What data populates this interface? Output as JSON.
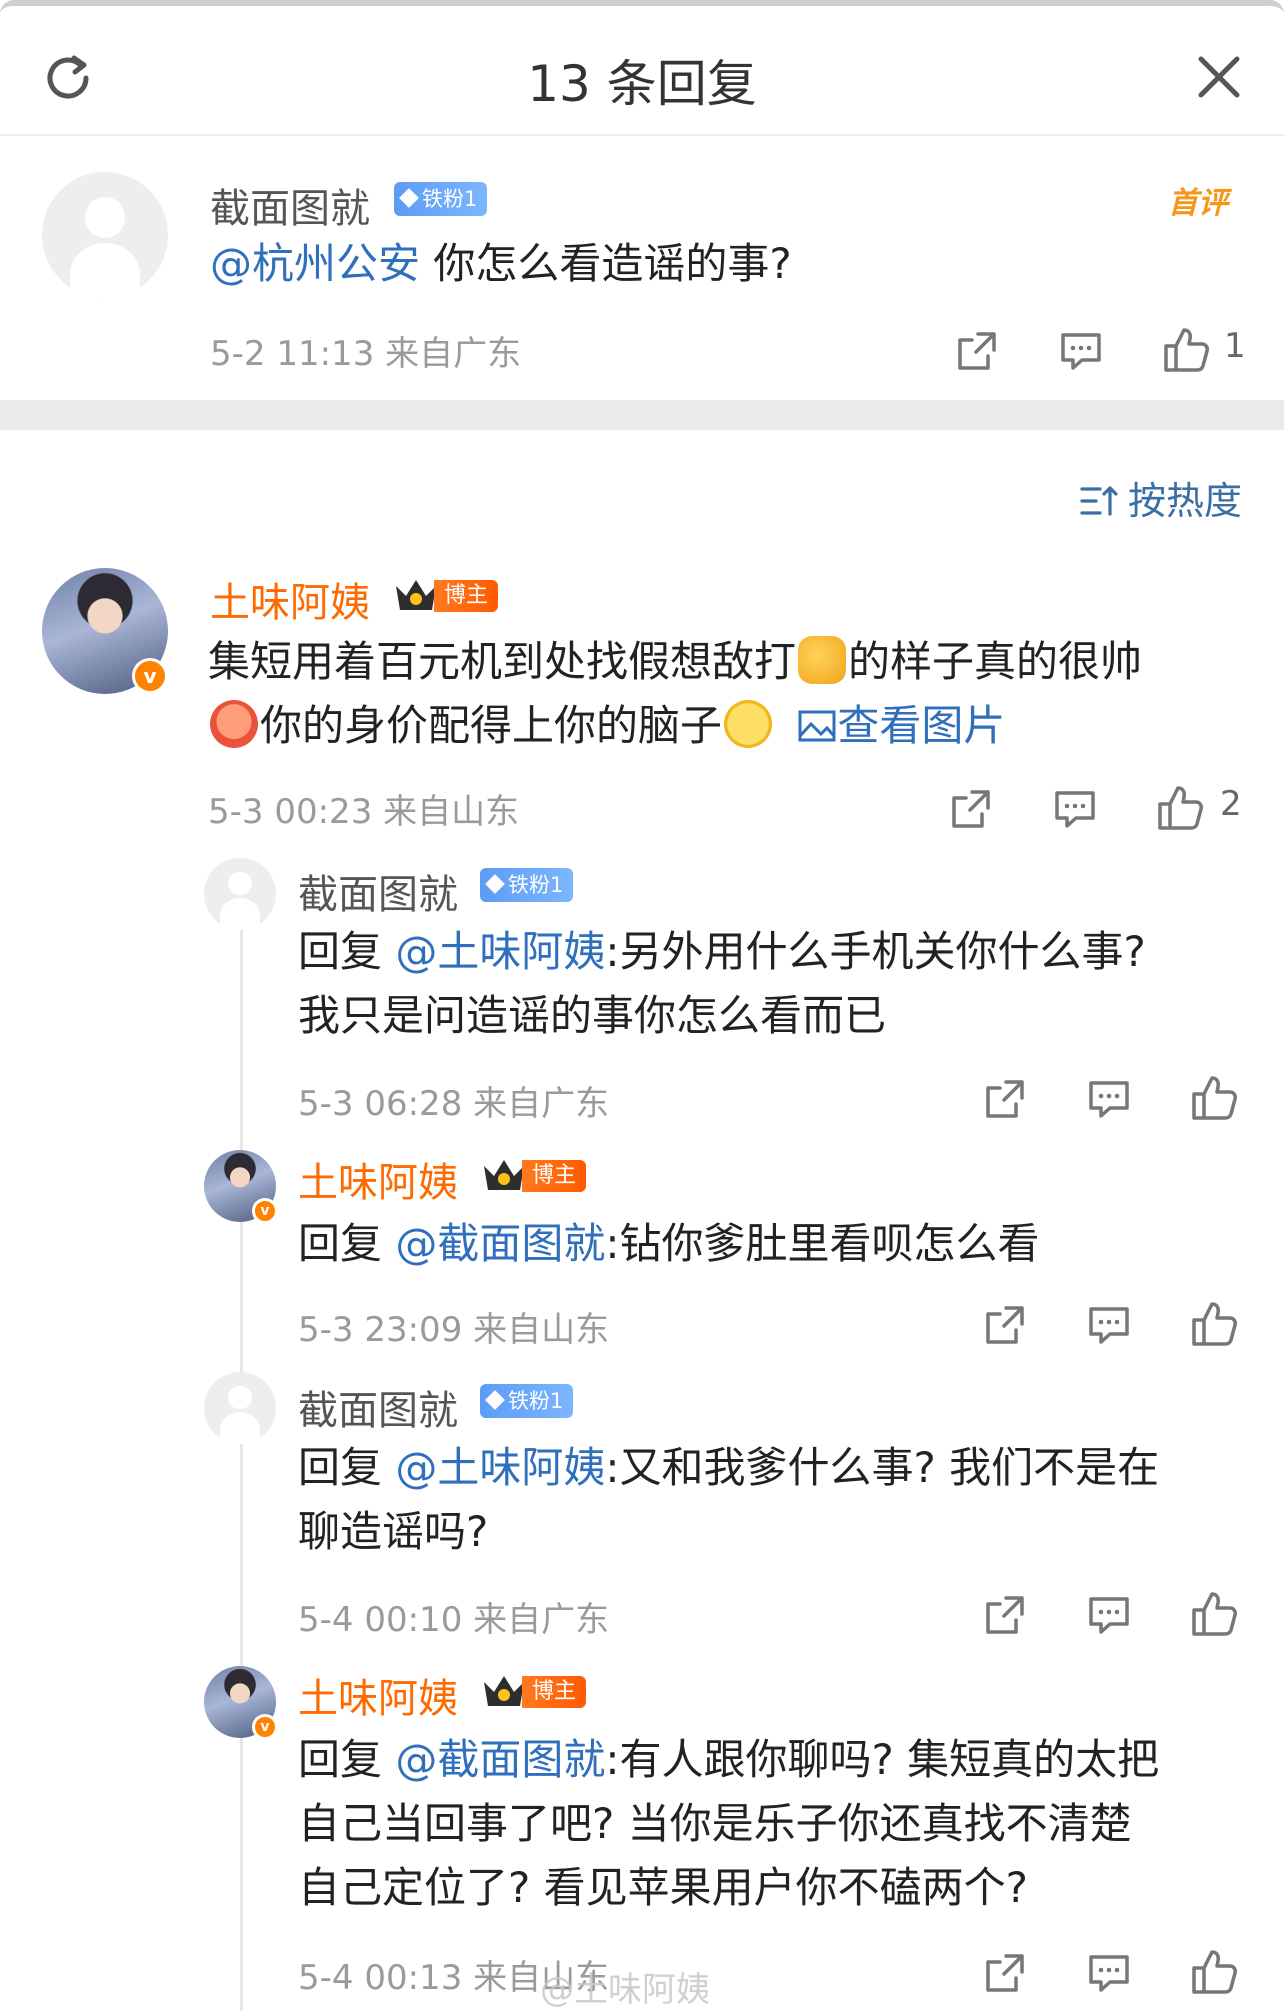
{
  "header": {
    "title": "13 条回复"
  },
  "root": {
    "username": "截面图就",
    "fan_badge": "铁粉1",
    "first_tag": "首评",
    "mention": "@杭州公安",
    "text": " 你怎么看造谣的事?",
    "meta": "5-2 11:13  来自广东",
    "likes": "1"
  },
  "sort": {
    "label": "按热度"
  },
  "main": {
    "username": "土味阿姨",
    "badge": "博主",
    "text1": "集短用着百元机到处找假想敌打",
    "text2": "的样子真的很帅",
    "text3": "你的身价配得上你的脑子",
    "view_image": "查看图片",
    "meta": "5-3 00:23  来自山东",
    "likes": "2"
  },
  "replies": [
    {
      "username": "截面图就",
      "badge": "铁粉1",
      "prefix": "回复 ",
      "mention": "@土味阿姨",
      "line1": ":另外用什么手机关你什么事?",
      "line2": "我只是问造谣的事你怎么看而已",
      "line3": "",
      "meta": "5-3 06:28  来自广东"
    },
    {
      "username": "土味阿姨",
      "badge": "博主",
      "prefix": "回复 ",
      "mention": "@截面图就",
      "line1": ":钻你爹肚里看呗怎么看",
      "line2": "",
      "line3": "",
      "meta": "5-3 23:09  来自山东"
    },
    {
      "username": "截面图就",
      "badge": "铁粉1",
      "prefix": "回复 ",
      "mention": "@土味阿姨",
      "line1": ":又和我爹什么事? 我们不是在",
      "line2": "聊造谣吗?",
      "line3": "",
      "meta": "5-4 00:10  来自广东"
    },
    {
      "username": "土味阿姨",
      "badge": "博主",
      "prefix": "回复 ",
      "mention": "@截面图就",
      "line1": ":有人跟你聊吗? 集短真的太把",
      "line2": "自己当回事了吧? 当你是乐子你还真找不清楚",
      "line3": "自己定位了? 看见苹果用户你不磕两个?",
      "meta": "5-4 00:13  来自山东"
    }
  ],
  "watermark": "@土味阿姨"
}
